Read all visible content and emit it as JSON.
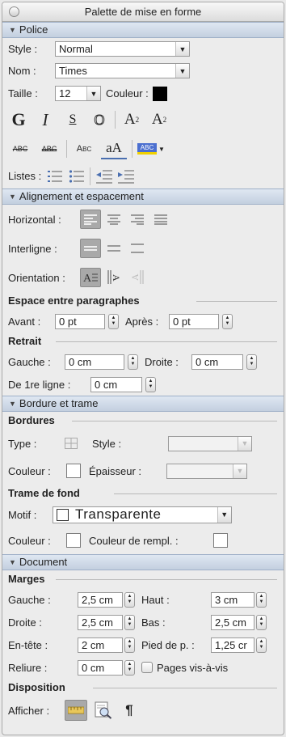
{
  "window": {
    "title": "Palette de mise en forme"
  },
  "police": {
    "section_title": "Police",
    "style_label": "Style :",
    "style_value": "Normal",
    "nom_label": "Nom :",
    "nom_value": "Times",
    "taille_label": "Taille :",
    "taille_value": "12",
    "couleur_label": "Couleur :",
    "couleur_color": "#000000",
    "fmt": {
      "bold": "G",
      "italic": "I",
      "underline": "S",
      "outline": "O",
      "superscript_base": "A",
      "superscript_mark": "2",
      "subscript_base": "A",
      "subscript_mark": "2",
      "strike1": "ABC",
      "strike2": "ABC",
      "smallcaps": "Abc",
      "case_top": "aA",
      "highlight": "ABC"
    },
    "listes_label": "Listes :"
  },
  "alignement": {
    "section_title": "Alignement et espacement",
    "horizontal_label": "Horizontal :",
    "interligne_label": "Interligne :",
    "orientation_label": "Orientation :",
    "espace_heading": "Espace entre paragraphes",
    "avant_label": "Avant :",
    "avant_value": "0 pt",
    "apres_label": "Après :",
    "apres_value": "0 pt",
    "retrait_heading": "Retrait",
    "gauche_label": "Gauche :",
    "gauche_value": "0 cm",
    "droite_label": "Droite :",
    "droite_value": "0 cm",
    "premiere_label": "De 1re ligne :",
    "premiere_value": "0 cm"
  },
  "bordure": {
    "section_title": "Bordure et trame",
    "bordures_heading": "Bordures",
    "type_label": "Type :",
    "style_label": "Style :",
    "couleur_label": "Couleur :",
    "epaisseur_label": "Épaisseur :",
    "trame_heading": "Trame de fond",
    "motif_label": "Motif :",
    "motif_value": "Transparente",
    "trame_couleur_label": "Couleur :",
    "remplissage_label": "Couleur de rempl. :"
  },
  "document": {
    "section_title": "Document",
    "marges_heading": "Marges",
    "gauche_label": "Gauche :",
    "gauche_value": "2,5 cm",
    "haut_label": "Haut :",
    "haut_value": "3 cm",
    "droite_label": "Droite :",
    "droite_value": "2,5 cm",
    "bas_label": "Bas :",
    "bas_value": "2,5 cm",
    "entete_label": "En-tête :",
    "entete_value": "2 cm",
    "pied_label": "Pied de p. :",
    "pied_value": "1,25 cr",
    "reliure_label": "Reliure :",
    "reliure_value": "0 cm",
    "pages_label": "Pages vis-à-vis",
    "disposition_heading": "Disposition",
    "afficher_label": "Afficher :",
    "pilcrow": "¶"
  }
}
